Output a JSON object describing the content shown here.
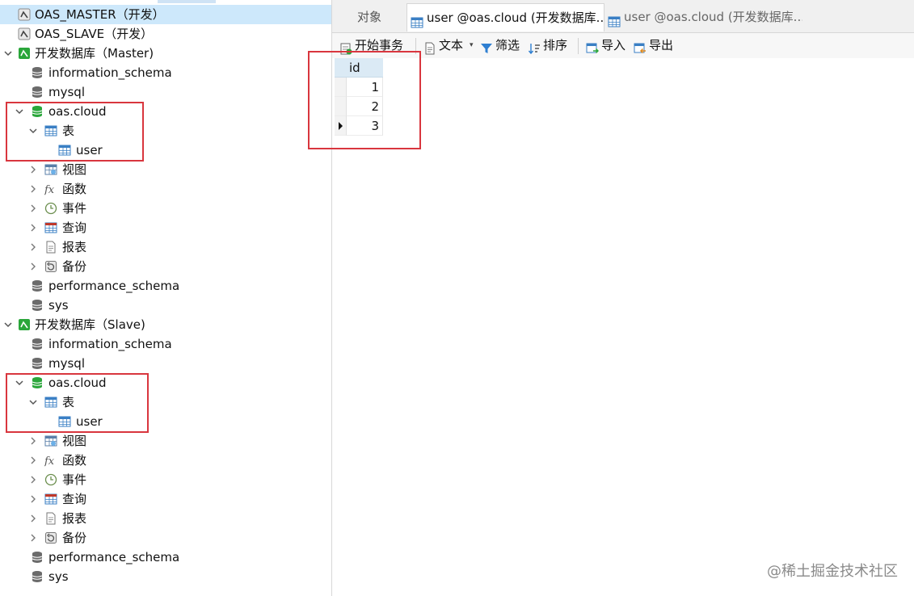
{
  "navigator": {
    "connections": [
      {
        "label": "OAS_MASTER（开发）",
        "selected": true
      },
      {
        "label": "OAS_SLAVE（开发）"
      },
      {
        "label": "开发数据库（Master)"
      },
      {
        "label": "开发数据库（Slave)"
      }
    ],
    "master": {
      "databases": [
        "information_schema",
        "mysql",
        "oas.cloud",
        "performance_schema",
        "sys"
      ],
      "objects": [
        "表",
        "user",
        "视图",
        "函数",
        "事件",
        "查询",
        "报表",
        "备份"
      ]
    },
    "slave": {
      "databases": [
        "information_schema",
        "mysql",
        "oas.cloud",
        "performance_schema",
        "sys"
      ],
      "objects": [
        "表",
        "user",
        "视图",
        "函数",
        "事件",
        "查询",
        "报表",
        "备份"
      ]
    }
  },
  "tabs": [
    {
      "label": "对象"
    },
    {
      "label": "user @oas.cloud (开发数据库..."
    },
    {
      "label": "user @oas.cloud (开发数据库..."
    }
  ],
  "toolbar": {
    "begin_tx": "开始事务",
    "text": "文本",
    "filter": "筛选",
    "sort": "排序",
    "import": "导入",
    "export": "导出"
  },
  "grid": {
    "columns": [
      "id"
    ],
    "rows": [
      "1",
      "2",
      "3"
    ],
    "current_row_index": 2
  },
  "watermark": "@稀土掘金技术社区",
  "colors": {
    "selection": "#cde8fb",
    "highlight_box": "#d9363e",
    "db_icon_active": "#2aa63a",
    "db_icon_idle": "#6b6b6b",
    "table_icon": "#3a7fc4"
  }
}
